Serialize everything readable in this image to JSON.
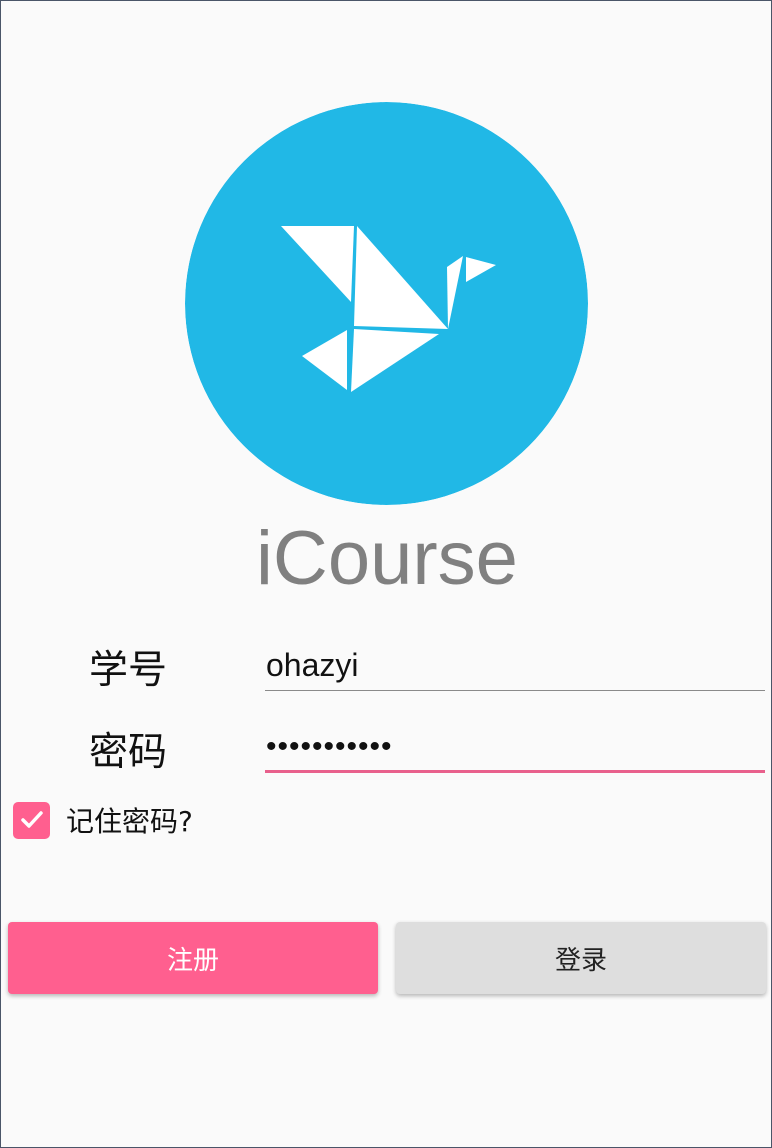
{
  "app": {
    "name": "iCourse"
  },
  "logo": {
    "icon": "origami-bird-icon",
    "background_color": "#21b8e6"
  },
  "form": {
    "student_id": {
      "label": "学号",
      "value": "ohazyi"
    },
    "password": {
      "label": "密码",
      "masked_value": "•••••••••••"
    },
    "remember_password": {
      "label": "记住密码?",
      "checked": true
    }
  },
  "buttons": {
    "register_label": "注册",
    "login_label": "登录"
  },
  "colors": {
    "accent": "#ff5f8f",
    "secondary_button": "#dedede"
  }
}
